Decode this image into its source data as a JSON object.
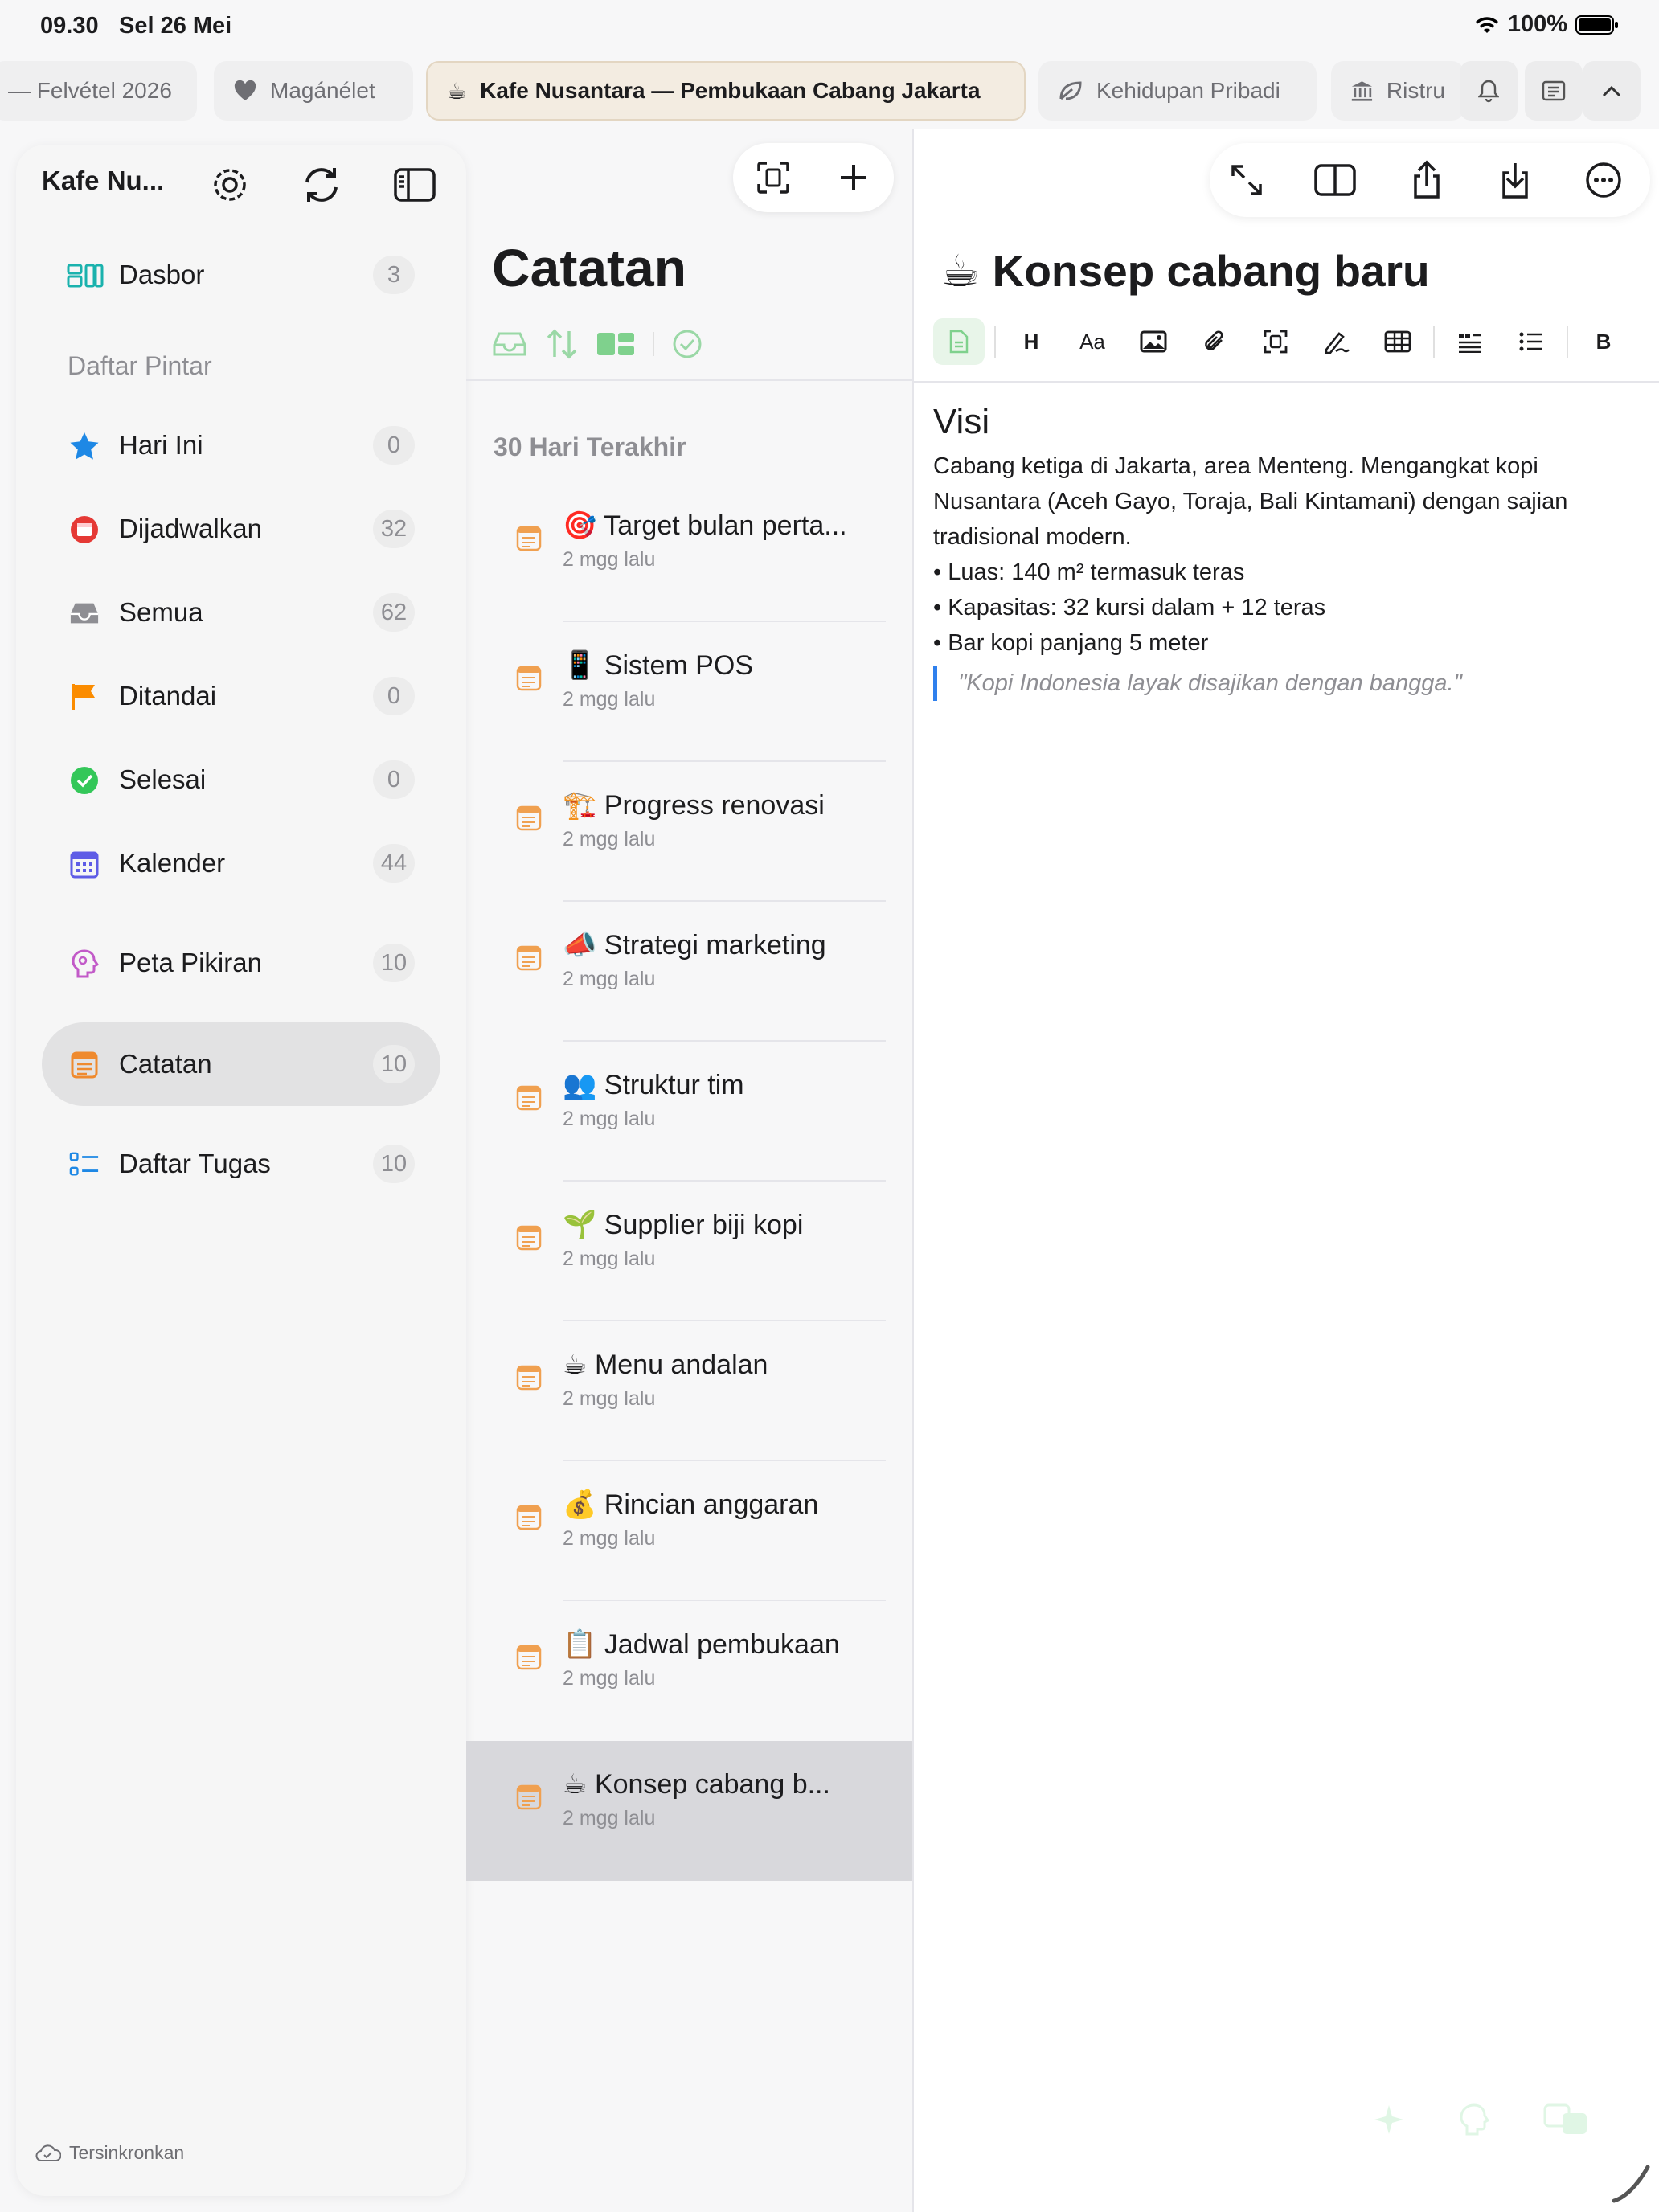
{
  "status_bar": {
    "time": "09.30",
    "date": "Sel 26 Mei",
    "battery": "100%"
  },
  "tabs": [
    {
      "label": "— Felvétel 2026",
      "icon": "none"
    },
    {
      "label": "Magánélet",
      "icon": "heart-icon"
    },
    {
      "label": "Kafe Nusantara — Pembukaan Cabang Jakarta",
      "icon": "coffee-icon",
      "active": true
    },
    {
      "label": "Kehidupan Pribadi",
      "icon": "leaf-icon"
    },
    {
      "label": "Ristru",
      "icon": "bank-icon"
    }
  ],
  "sidebar": {
    "title": "Kafe Nu...",
    "smart_lists_label": "Daftar Pintar",
    "dashboard": {
      "label": "Dasbor",
      "count": "3"
    },
    "items": [
      {
        "label": "Hari Ini",
        "count": "0",
        "icon": "star-icon",
        "color": "#1e88e5"
      },
      {
        "label": "Dijadwalkan",
        "count": "32",
        "icon": "calendar-clock-icon",
        "color": "#e53935"
      },
      {
        "label": "Semua",
        "count": "62",
        "icon": "inbox-icon",
        "color": "#8e8e93"
      },
      {
        "label": "Ditandai",
        "count": "0",
        "icon": "flag-icon",
        "color": "#fb8c00"
      },
      {
        "label": "Selesai",
        "count": "0",
        "icon": "check-circle-icon",
        "color": "#34c759"
      },
      {
        "label": "Kalender",
        "count": "44",
        "icon": "calendar-icon",
        "color": "#5e5ce6"
      }
    ],
    "mindmap": {
      "label": "Peta Pikiran",
      "count": "10"
    },
    "notes": {
      "label": "Catatan",
      "count": "10"
    },
    "tasks": {
      "label": "Daftar Tugas",
      "count": "10"
    },
    "sync_status": "Tersinkronkan"
  },
  "notes_list": {
    "title": "Catatan",
    "section": "30 Hari Terakhir",
    "notes": [
      {
        "emoji": "🎯",
        "title": "Target bulan perta...",
        "time": "2 mgg lalu"
      },
      {
        "emoji": "📱",
        "title": "Sistem POS",
        "time": "2 mgg lalu"
      },
      {
        "emoji": "🏗️",
        "title": "Progress renovasi",
        "time": "2 mgg lalu"
      },
      {
        "emoji": "📣",
        "title": "Strategi marketing",
        "time": "2 mgg lalu"
      },
      {
        "emoji": "👥",
        "title": "Struktur tim",
        "time": "2 mgg lalu"
      },
      {
        "emoji": "🌱",
        "title": "Supplier biji kopi",
        "time": "2 mgg lalu"
      },
      {
        "emoji": "☕",
        "title": "Menu andalan",
        "time": "2 mgg lalu"
      },
      {
        "emoji": "💰",
        "title": "Rincian anggaran",
        "time": "2 mgg lalu"
      },
      {
        "emoji": "📋",
        "title": "Jadwal pembukaan",
        "time": "2 mgg lalu"
      },
      {
        "emoji": "☕",
        "title": "Konsep cabang b...",
        "time": "2 mgg lalu",
        "selected": true
      }
    ]
  },
  "editor": {
    "title_emoji": "☕",
    "title": "Konsep cabang baru",
    "toolbar": [
      "H",
      "Aa",
      "B"
    ],
    "heading": "Visi",
    "paragraph": "Cabang ketiga di Jakarta, area Menteng. Mengangkat kopi Nusantara (Aceh Gayo, Toraja, Bali Kintamani) dengan sajian tradisional modern.",
    "bullets": [
      "Luas: 140 m² termasuk teras",
      "Kapasitas: 32 kursi dalam + 12 teras",
      "Bar kopi panjang 5 meter"
    ],
    "quote": "\"Kopi Indonesia layak disajikan dengan bangga.\""
  },
  "colors": {
    "accent_green": "#34c759",
    "note_icon_orange": "#f0a050",
    "quote_bar": "#2f80ed"
  }
}
